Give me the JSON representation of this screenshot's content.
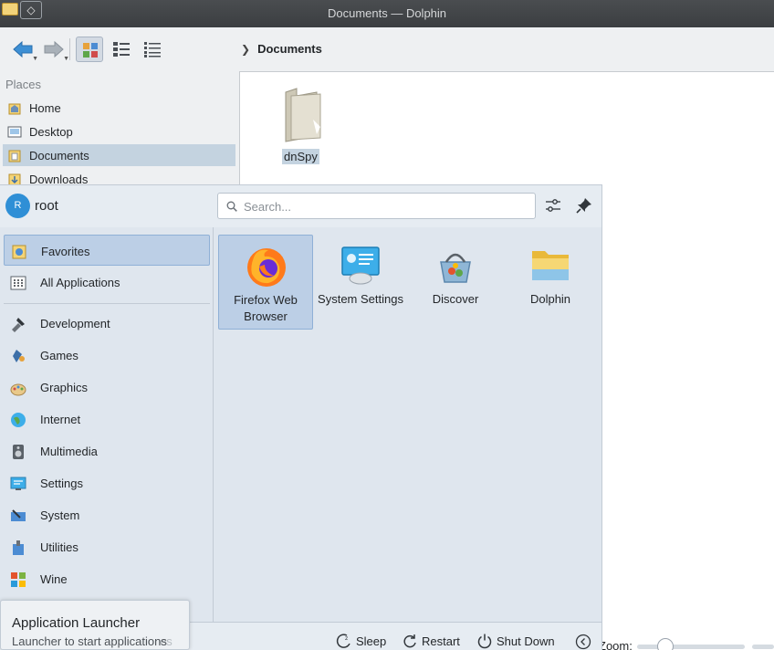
{
  "window": {
    "title": "Documents — Dolphin"
  },
  "breadcrumb": {
    "current": "Documents"
  },
  "places": {
    "header": "Places",
    "items": [
      {
        "label": "Home",
        "icon": "home-icon"
      },
      {
        "label": "Desktop",
        "icon": "desktop-icon"
      },
      {
        "label": "Documents",
        "icon": "documents-icon",
        "active": true
      },
      {
        "label": "Downloads",
        "icon": "downloads-icon"
      }
    ]
  },
  "files": [
    {
      "name": "dnSpy",
      "type": "folder"
    }
  ],
  "statusbar": {
    "zoom_label": "Zoom:"
  },
  "launcher": {
    "user": {
      "initial": "R",
      "name": "root"
    },
    "search": {
      "placeholder": "Search..."
    },
    "categories": [
      {
        "label": "Favorites",
        "icon": "favorites-icon",
        "active": true
      },
      {
        "label": "All Applications",
        "icon": "all-applications-icon"
      },
      {
        "label": "Development",
        "icon": "development-icon"
      },
      {
        "label": "Games",
        "icon": "games-icon"
      },
      {
        "label": "Graphics",
        "icon": "graphics-icon"
      },
      {
        "label": "Internet",
        "icon": "internet-icon"
      },
      {
        "label": "Multimedia",
        "icon": "multimedia-icon"
      },
      {
        "label": "Settings",
        "icon": "settings-icon"
      },
      {
        "label": "System",
        "icon": "system-icon"
      },
      {
        "label": "Utilities",
        "icon": "utilities-icon"
      },
      {
        "label": "Wine",
        "icon": "wine-icon"
      }
    ],
    "favorites": [
      {
        "label": "Firefox Web Browser",
        "icon": "firefox-icon",
        "active": true
      },
      {
        "label": "System Settings",
        "icon": "system-settings-icon"
      },
      {
        "label": "Discover",
        "icon": "discover-icon"
      },
      {
        "label": "Dolphin",
        "icon": "dolphin-icon"
      }
    ],
    "footer": {
      "sleep": "Sleep",
      "restart": "Restart",
      "shutdown": "Shut Down"
    }
  },
  "tooltip": {
    "title": "Application Launcher",
    "subtitle": "Launcher to start applications",
    "ghost_text": "es"
  },
  "colors": {
    "accent": "#3daee9",
    "selection": "#bccfe6",
    "titlebar": "#3b3e41"
  }
}
